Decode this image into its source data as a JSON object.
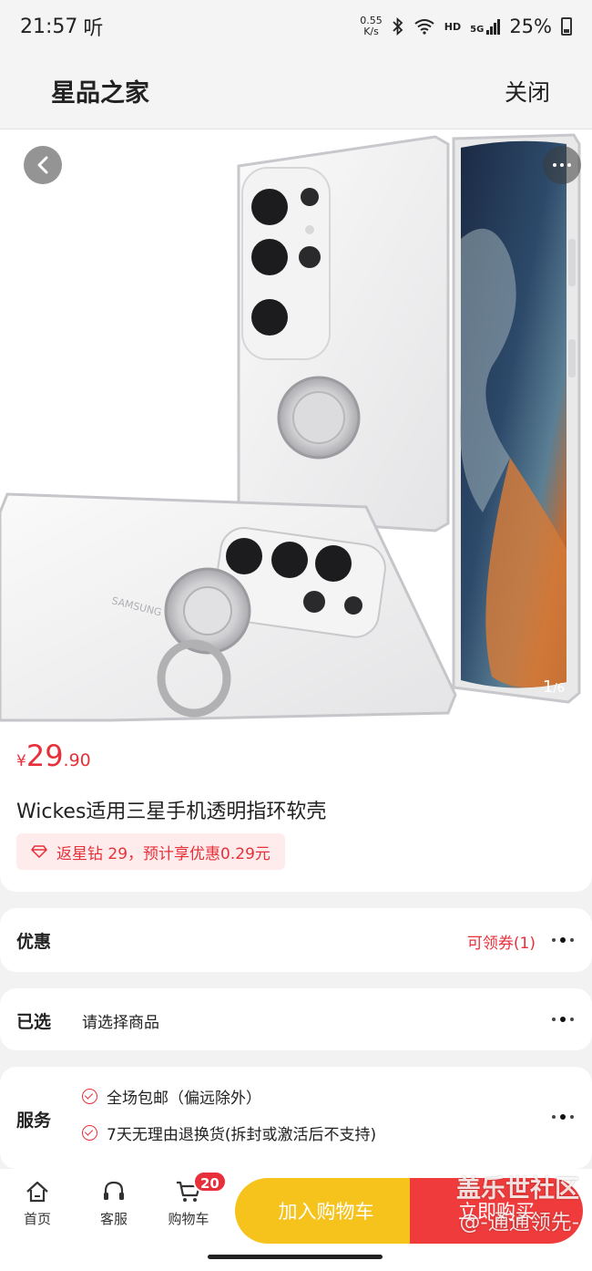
{
  "status": {
    "time": "21:57",
    "notif": "听",
    "net_speed_value": "0.55",
    "net_speed_unit": "K/s",
    "hd": "HD",
    "signal": "5G",
    "battery": "25%"
  },
  "header": {
    "title": "星品之家",
    "close_label": "关闭"
  },
  "gallery": {
    "current": "1",
    "total": "6",
    "brand_on_case": "SAMSUNG"
  },
  "product": {
    "currency": "¥",
    "price_int": "29",
    "price_dec": ".90",
    "title": "Wickes适用三星手机透明指环软壳",
    "rebate_text": "返星钻 29，预计享优惠0.29元"
  },
  "offers": {
    "label": "优惠",
    "coupon_text": "可领券(1)"
  },
  "selected": {
    "label": "已选",
    "text": "请选择商品"
  },
  "service": {
    "label": "服务",
    "items": [
      "全场包邮（偏远除外）",
      "7天无理由退换货(拆封或激活后不支持)"
    ]
  },
  "bottom": {
    "home_label": "首页",
    "service_label": "客服",
    "cart_label": "购物车",
    "cart_count": "20",
    "add_cart_label": "加入购物车",
    "buy_label": "立即购买",
    "watermark_main": "盖乐世社区",
    "watermark_sub": "@-通通领先-"
  },
  "colors": {
    "accent": "#e8303b",
    "add_cart": "#f6c21c",
    "buy": "#ef3b3b"
  }
}
